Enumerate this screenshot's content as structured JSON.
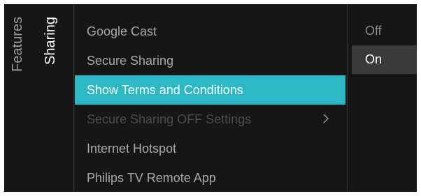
{
  "breadcrumb": {
    "parent": "Features",
    "current": "Sharing"
  },
  "menu": {
    "items": [
      {
        "label": "Google Cast",
        "state": "normal"
      },
      {
        "label": "Secure Sharing",
        "state": "normal"
      },
      {
        "label": "Show Terms and Conditions",
        "state": "selected"
      },
      {
        "label": "Secure Sharing OFF Settings",
        "state": "disabled",
        "has_submenu": true,
        "chevron_icon": "chevron-right-icon"
      },
      {
        "label": "Internet Hotspot",
        "state": "normal"
      },
      {
        "label": "Philips TV Remote App",
        "state": "normal"
      }
    ]
  },
  "options": {
    "items": [
      {
        "label": "Off",
        "active": false
      },
      {
        "label": "On",
        "active": true
      }
    ]
  },
  "colors": {
    "background": "#161616",
    "highlight": "#2cb8c4",
    "active_option": "#3a3a3a",
    "text_normal": "#a8a8a8",
    "text_disabled": "#4c4c4c"
  }
}
